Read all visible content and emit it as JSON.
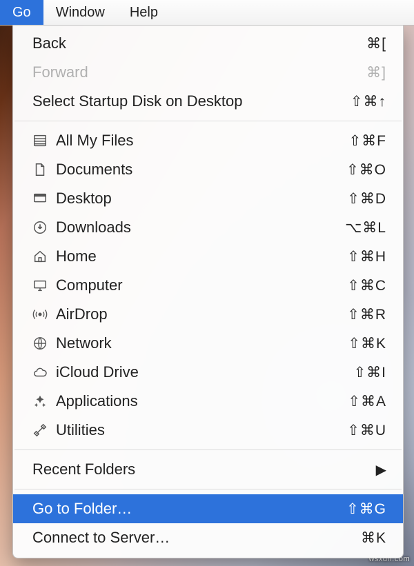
{
  "menubar": {
    "items": [
      {
        "label": "Go",
        "active": true
      },
      {
        "label": "Window",
        "active": false
      },
      {
        "label": "Help",
        "active": false
      }
    ]
  },
  "menu": {
    "sections": [
      [
        {
          "id": "back",
          "label": "Back",
          "shortcut": "⌘[",
          "disabled": false
        },
        {
          "id": "forward",
          "label": "Forward",
          "shortcut": "⌘]",
          "disabled": true
        },
        {
          "id": "select-startup-disk",
          "label": "Select Startup Disk on Desktop",
          "shortcut": "⇧⌘↑",
          "disabled": false
        }
      ],
      [
        {
          "id": "all-my-files",
          "icon": "all-my-files-icon",
          "label": "All My Files",
          "shortcut": "⇧⌘F"
        },
        {
          "id": "documents",
          "icon": "documents-icon",
          "label": "Documents",
          "shortcut": "⇧⌘O"
        },
        {
          "id": "desktop",
          "icon": "desktop-icon",
          "label": "Desktop",
          "shortcut": "⇧⌘D"
        },
        {
          "id": "downloads",
          "icon": "downloads-icon",
          "label": "Downloads",
          "shortcut": "⌥⌘L"
        },
        {
          "id": "home",
          "icon": "home-icon",
          "label": "Home",
          "shortcut": "⇧⌘H"
        },
        {
          "id": "computer",
          "icon": "computer-icon",
          "label": "Computer",
          "shortcut": "⇧⌘C"
        },
        {
          "id": "airdrop",
          "icon": "airdrop-icon",
          "label": "AirDrop",
          "shortcut": "⇧⌘R"
        },
        {
          "id": "network",
          "icon": "network-icon",
          "label": "Network",
          "shortcut": "⇧⌘K"
        },
        {
          "id": "icloud-drive",
          "icon": "icloud-drive-icon",
          "label": "iCloud Drive",
          "shortcut": "⇧⌘I"
        },
        {
          "id": "applications",
          "icon": "applications-icon",
          "label": "Applications",
          "shortcut": "⇧⌘A"
        },
        {
          "id": "utilities",
          "icon": "utilities-icon",
          "label": "Utilities",
          "shortcut": "⇧⌘U"
        }
      ],
      [
        {
          "id": "recent-folders",
          "label": "Recent Folders",
          "submenu": true
        }
      ],
      [
        {
          "id": "go-to-folder",
          "label": "Go to Folder…",
          "shortcut": "⇧⌘G",
          "highlighted": true
        },
        {
          "id": "connect-to-server",
          "label": "Connect to Server…",
          "shortcut": "⌘K"
        }
      ]
    ]
  },
  "attribution": "wsxdn.com",
  "colors": {
    "highlight": "#2d72db"
  }
}
